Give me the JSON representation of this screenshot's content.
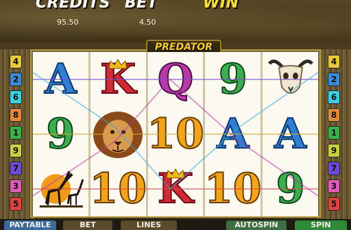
{
  "meters": {
    "credits": {
      "label": "CREDITS",
      "value": "95.50"
    },
    "bet": {
      "label": "BET",
      "value": "4.50"
    },
    "win": {
      "label": "WIN",
      "value": ""
    }
  },
  "title": "PREDATOR",
  "reels": [
    [
      {
        "symbol": "A",
        "color": "blue"
      },
      {
        "symbol": "9",
        "color": "green"
      },
      {
        "symbol": "antelope-icon"
      }
    ],
    [
      {
        "symbol": "K",
        "color": "red",
        "crown": true
      },
      {
        "symbol": "lion-icon"
      },
      {
        "symbol": "10",
        "color": "orange"
      }
    ],
    [
      {
        "symbol": "Q",
        "color": "purple"
      },
      {
        "symbol": "10",
        "color": "orange"
      },
      {
        "symbol": "K",
        "color": "red",
        "crown": true
      }
    ],
    [
      {
        "symbol": "9",
        "color": "green"
      },
      {
        "symbol": "A",
        "color": "blue"
      },
      {
        "symbol": "10",
        "color": "orange"
      }
    ],
    [
      {
        "symbol": "buffalo-skull-icon"
      },
      {
        "symbol": "A",
        "color": "blue"
      },
      {
        "symbol": "9",
        "color": "green"
      }
    ]
  ],
  "left_markers": [
    "4",
    "2",
    "6",
    "8",
    "1",
    "9",
    "7",
    "3",
    "5"
  ],
  "right_markers": [
    "4",
    "2",
    "6",
    "8",
    "1",
    "9",
    "7",
    "3",
    "5"
  ],
  "bottom_buttons": {
    "paytable": "PAYTABLE",
    "bet": "BET",
    "lines": "LINES",
    "autospin": "AUTOSPIN",
    "spin": "SPIN"
  },
  "colors": {
    "blue": "#2f7fd6",
    "red": "#d12a37",
    "purple": "#b63aa8",
    "green": "#3dad52",
    "orange": "#f2a51c"
  }
}
